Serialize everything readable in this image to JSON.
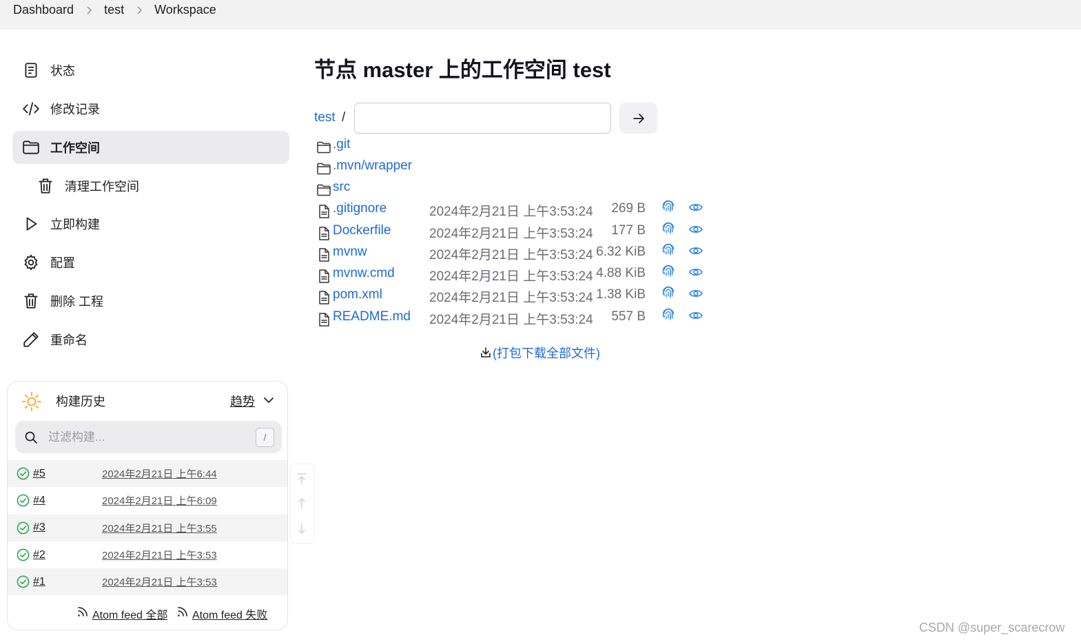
{
  "breadcrumb": {
    "items": [
      "Dashboard",
      "test",
      "Workspace"
    ]
  },
  "sidebar": {
    "items": [
      {
        "label": "状态",
        "icon": "document-icon"
      },
      {
        "label": "修改记录",
        "icon": "code-icon"
      },
      {
        "label": "工作空间",
        "icon": "folder-icon",
        "active": true
      },
      {
        "label": "清理工作空间",
        "icon": "trash-icon"
      },
      {
        "label": "立即构建",
        "icon": "play-icon"
      },
      {
        "label": "配置",
        "icon": "gear-icon"
      },
      {
        "label": "删除 工程",
        "icon": "trash-icon"
      },
      {
        "label": "重命名",
        "icon": "pencil-icon"
      }
    ]
  },
  "history": {
    "title": "构建历史",
    "trend_label": "趋势",
    "search_placeholder": "过滤构建...",
    "shortcut": "/",
    "runs": [
      {
        "number": "#5",
        "date": "2024年2月21日 上午6:44"
      },
      {
        "number": "#4",
        "date": "2024年2月21日 上午6:09"
      },
      {
        "number": "#3",
        "date": "2024年2月21日 上午3:55"
      },
      {
        "number": "#2",
        "date": "2024年2月21日 上午3:53"
      },
      {
        "number": "#1",
        "date": "2024年2月21日 上午3:53"
      }
    ],
    "feed_all": "Atom feed 全部",
    "feed_failed": "Atom feed 失败"
  },
  "main": {
    "title": "节点 master 上的工作空间 test",
    "path_root": "test",
    "path_sep": "/",
    "path_value": "",
    "folders": [
      ".git",
      ".mvn/wrapper",
      "src"
    ],
    "files": [
      {
        "name": ".gitignore",
        "date": "2024年2月21日 上午3:53:24",
        "size": "269 B"
      },
      {
        "name": "Dockerfile",
        "date": "2024年2月21日 上午3:53:24",
        "size": "177 B"
      },
      {
        "name": "mvnw",
        "date": "2024年2月21日 上午3:53:24",
        "size": "6.32 KiB"
      },
      {
        "name": "mvnw.cmd",
        "date": "2024年2月21日 上午3:53:24",
        "size": "4.88 KiB"
      },
      {
        "name": "pom.xml",
        "date": "2024年2月21日 上午3:53:24",
        "size": "1.38 KiB"
      },
      {
        "name": "README.md",
        "date": "2024年2月21日 上午3:53:24",
        "size": "557 B"
      }
    ],
    "download_label": "(打包下载全部文件)"
  },
  "watermark": "CSDN @super_scarecrow",
  "colors": {
    "link": "#1e6ad6",
    "success": "#1ea446",
    "sun": "#f5a623"
  }
}
